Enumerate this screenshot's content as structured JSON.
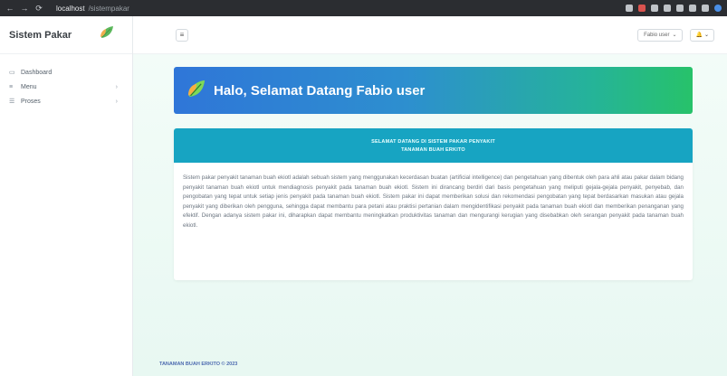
{
  "browser": {
    "url_host": "localhost",
    "url_path": "/sistempakar",
    "back": "←",
    "forward": "→",
    "reload": "⟳"
  },
  "sidebar": {
    "brand": "Sistem Pakar",
    "items": [
      {
        "icon": "▭",
        "label": "Dashboard",
        "chevron": ""
      },
      {
        "icon": "≡",
        "label": "Menu",
        "chevron": "›"
      },
      {
        "icon": "☰",
        "label": "Proses",
        "chevron": "›"
      }
    ]
  },
  "topbar": {
    "toggle": "≡",
    "user_label": "Fabio user",
    "user_caret": "⌄",
    "bell": "🔔",
    "bell_caret": "⌄"
  },
  "hero": {
    "title": "Halo, Selamat Datang Fabio user"
  },
  "card": {
    "heading_line1": "SELAMAT DATANG DI SISTEM PAKAR PENYAKIT",
    "heading_line2": "TANAMAN BUAH ERKITO",
    "body": "Sistem pakar penyakit tanaman buah ekiotl adalah sebuah sistem yang menggunakan kecerdasan buatan (artificial intelligence) dan pengetahuan yang dibentuk oleh para ahli atau pakar dalam bidang penyakit tanaman buah ekiotl untuk mendiagnosis penyakit pada tanaman buah ekiotl. Sistem ini dirancang berdiri dari basis pengetahuan yang meliputi gejala-gejala penyakit, penyebab, dan pengobatan yang tepat untuk setiap jenis penyakit pada tanaman buah ekiotl. Sistem pakar ini dapat memberikan solusi dan rekomendasi pengobatan yang tepat berdasarkan masukan atau gejala penyakit yang diberikan oleh pengguna, sehingga dapat membantu para petani atau praktisi pertanian dalam mengidentifikasi penyakit pada tanaman buah ekiotl dan memberikan penanganan yang efektif. Dengan adanya sistem pakar ini, diharapkan dapat membantu meningkatkan produktivitas tanaman dan mengurangi kerugian yang disebabkan oleh serangan penyakit pada tanaman buah ekiotl."
  },
  "footer": {
    "text": "TANAMAN BUAH ERKITO © 2023"
  },
  "colors": {
    "hero_start": "#2f76d8",
    "hero_end": "#27c26a",
    "card_header": "#17a4c2",
    "main_bg": "#eefaf5"
  }
}
